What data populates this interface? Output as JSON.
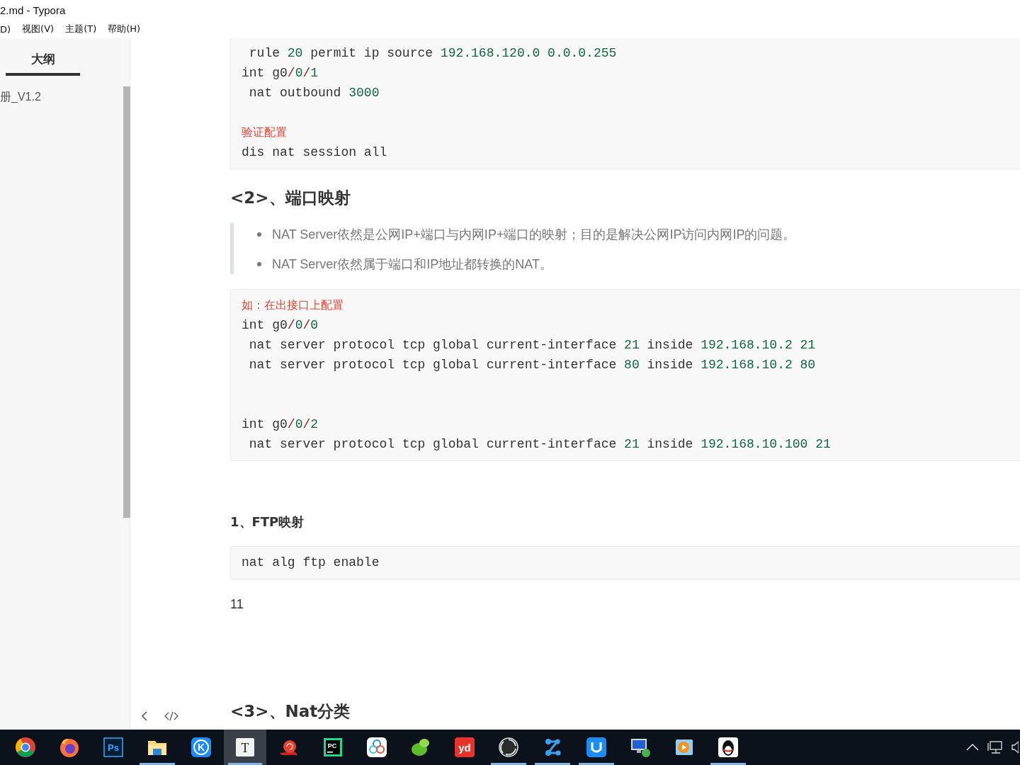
{
  "window": {
    "title": "2.md - Typora"
  },
  "menu": [
    "D)",
    "视图(V)",
    "主题(T)",
    "帮助(H)"
  ],
  "sidebar": {
    "tabs": [
      {
        "label": "大纲",
        "selected": true
      }
    ],
    "items": [
      {
        "label": "册_V1.2"
      }
    ]
  },
  "document": [
    {
      "kind": "code",
      "cut_top": true,
      "lines": [
        {
          "kind": "code",
          "tokens": [
            {
              "kind": "text",
              "text": " rule "
            },
            {
              "kind": "num",
              "text": "20"
            },
            {
              "kind": "text",
              "text": " permit ip source "
            },
            {
              "kind": "num",
              "text": "192.168.120.0 0.0.0.255"
            }
          ]
        },
        {
          "kind": "code",
          "tokens": [
            {
              "kind": "text",
              "text": "int g0"
            },
            {
              "kind": "op",
              "text": "/"
            },
            {
              "kind": "num",
              "text": "0"
            },
            {
              "kind": "op",
              "text": "/"
            },
            {
              "kind": "num",
              "text": "1"
            }
          ]
        },
        {
          "kind": "code",
          "tokens": [
            {
              "kind": "text",
              "text": " nat outbound "
            },
            {
              "kind": "num",
              "text": "3000"
            }
          ]
        },
        {
          "kind": "blank"
        },
        {
          "kind": "comment",
          "text": "验证配置"
        },
        {
          "kind": "code",
          "tokens": [
            {
              "kind": "text",
              "text": "dis nat session all"
            }
          ]
        }
      ]
    },
    {
      "kind": "h2",
      "text": "<2>、端口映射"
    },
    {
      "kind": "quote",
      "items": [
        "NAT Server依然是公网IP+端口与内网IP+端口的映射；目的是解决公网IP访问内网IP的问题。",
        "NAT Server依然属于端口和IP地址都转换的NAT。"
      ]
    },
    {
      "kind": "code",
      "cut_top": false,
      "lines": [
        {
          "kind": "comment",
          "text": "如：在出接口上配置"
        },
        {
          "kind": "code",
          "tokens": [
            {
              "kind": "text",
              "text": "int g0"
            },
            {
              "kind": "op",
              "text": "/"
            },
            {
              "kind": "num",
              "text": "0"
            },
            {
              "kind": "op",
              "text": "/"
            },
            {
              "kind": "num",
              "text": "0"
            }
          ]
        },
        {
          "kind": "code",
          "tokens": [
            {
              "kind": "text",
              "text": " nat server protocol tcp global current-interface "
            },
            {
              "kind": "num",
              "text": "21"
            },
            {
              "kind": "text",
              "text": " inside "
            },
            {
              "kind": "num",
              "text": "192.168.10.2 21"
            }
          ]
        },
        {
          "kind": "code",
          "tokens": [
            {
              "kind": "text",
              "text": " nat server protocol tcp global current-interface "
            },
            {
              "kind": "num",
              "text": "80"
            },
            {
              "kind": "text",
              "text": " inside "
            },
            {
              "kind": "num",
              "text": "192.168.10.2 80"
            }
          ]
        },
        {
          "kind": "blank"
        },
        {
          "kind": "blank"
        },
        {
          "kind": "code",
          "tokens": [
            {
              "kind": "text",
              "text": "int g0"
            },
            {
              "kind": "op",
              "text": "/"
            },
            {
              "kind": "num",
              "text": "0"
            },
            {
              "kind": "op",
              "text": "/"
            },
            {
              "kind": "num",
              "text": "2"
            }
          ]
        },
        {
          "kind": "code",
          "tokens": [
            {
              "kind": "text",
              "text": " nat server protocol tcp global current-interface "
            },
            {
              "kind": "num",
              "text": "21"
            },
            {
              "kind": "text",
              "text": " inside "
            },
            {
              "kind": "num",
              "text": "192.168.10.100 21"
            }
          ]
        }
      ]
    },
    {
      "kind": "h4",
      "text": "1、FTP映射"
    },
    {
      "kind": "code",
      "cut_top": false,
      "lines": [
        {
          "kind": "code",
          "tokens": [
            {
              "kind": "text",
              "text": "nat alg ftp enable"
            }
          ]
        }
      ]
    },
    {
      "kind": "para",
      "text": "11"
    },
    {
      "kind": "h2",
      "text": "<3>、Nat分类"
    }
  ],
  "taskbar": {
    "items": [
      {
        "kind": "chrome",
        "running": false,
        "selected": false
      },
      {
        "kind": "firefox",
        "running": false,
        "selected": false
      },
      {
        "kind": "ps",
        "label": "Ps",
        "running": false,
        "selected": false
      },
      {
        "kind": "folder",
        "running": true,
        "selected": false
      },
      {
        "kind": "kapp",
        "label": "K",
        "running": false,
        "selected": false
      },
      {
        "kind": "typora",
        "label": "T",
        "running": true,
        "selected": true
      },
      {
        "kind": "snail",
        "running": false,
        "selected": false
      },
      {
        "kind": "pc",
        "label": "PC",
        "running": false,
        "selected": false
      },
      {
        "kind": "cloud",
        "running": false,
        "selected": false
      },
      {
        "kind": "leaf",
        "running": false,
        "selected": false
      },
      {
        "kind": "yd",
        "label": "yd",
        "running": false,
        "selected": false
      },
      {
        "kind": "aperture",
        "running": true,
        "selected": false
      },
      {
        "kind": "nodes",
        "running": true,
        "selected": false
      },
      {
        "kind": "uapp",
        "running": true,
        "selected": false
      },
      {
        "kind": "monitor",
        "running": false,
        "selected": false
      },
      {
        "kind": "play",
        "running": false,
        "selected": false
      },
      {
        "kind": "penguin",
        "running": true,
        "selected": false
      }
    ]
  }
}
